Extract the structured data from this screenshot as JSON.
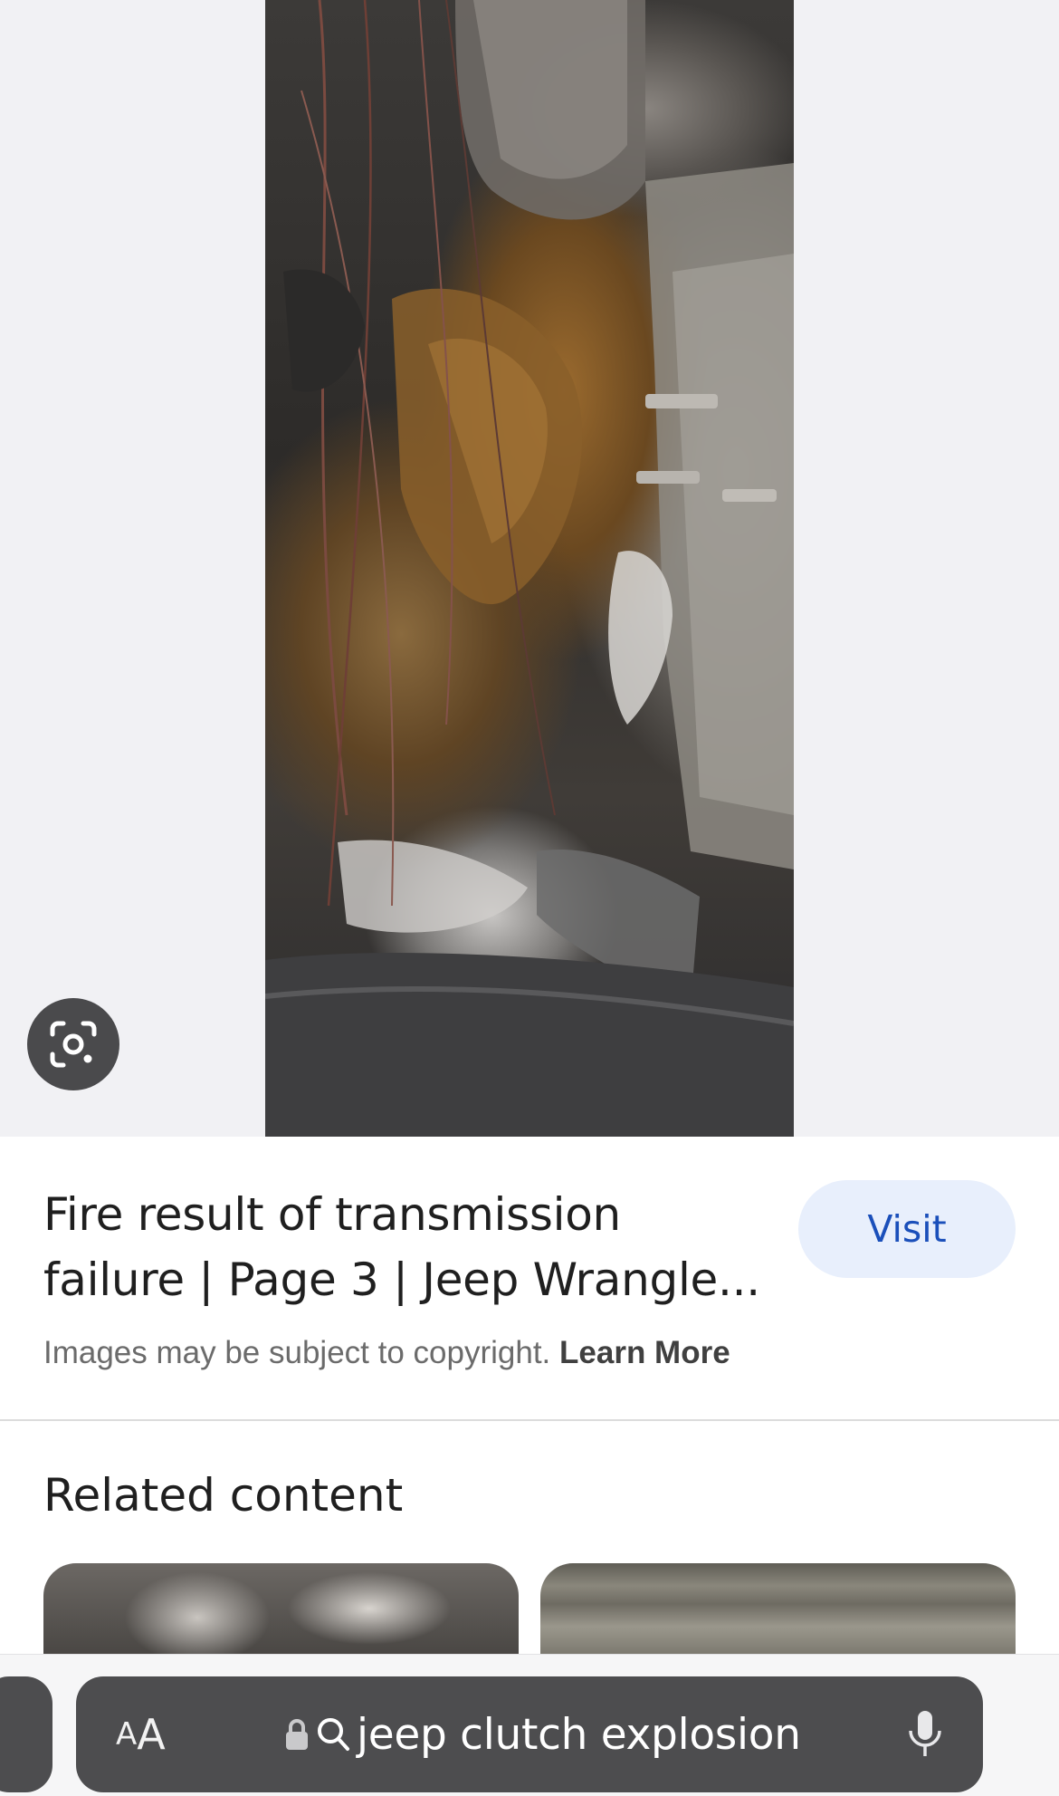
{
  "viewer": {
    "image_description_icon": "photo",
    "lens_icon": "google-lens-icon"
  },
  "result": {
    "title": "Fire result of transmission failure | Page 3 | Jeep Wrangle...",
    "visit_label": "Visit",
    "copyright_text": "Images may be subject to copyright.",
    "learn_more_label": "Learn More"
  },
  "related": {
    "title": "Related content"
  },
  "browser": {
    "aa_small": "A",
    "aa_big": "A",
    "address_text": "jeep clutch explosion",
    "lock_icon": "lock-icon",
    "search_icon": "search-icon",
    "mic_icon": "microphone-icon"
  },
  "colors": {
    "visit_bg": "#e8effc",
    "visit_text": "#1a4fba",
    "address_bar_bg": "#4d4d4f"
  }
}
